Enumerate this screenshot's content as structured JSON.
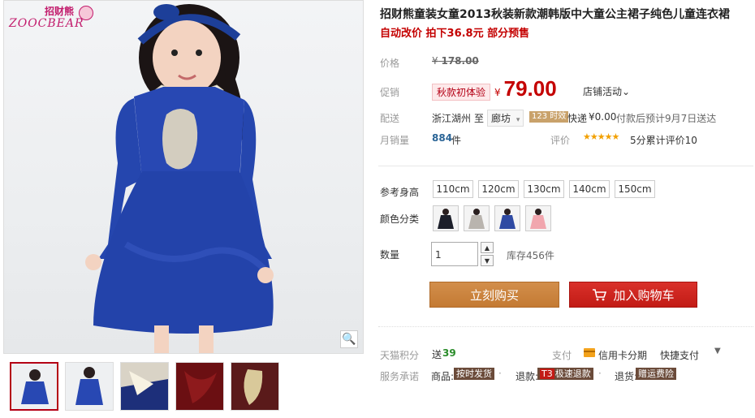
{
  "brand": {
    "name_cn": "招财熊",
    "name_en": "ZOOCBEAR"
  },
  "product": {
    "title": "招财熊童装女童2013秋装新款潮韩版中大童公主裙子纯色儿童连衣裙",
    "promo_line": "自动改价 拍下36.8元 部分预售"
  },
  "price": {
    "label": "价格",
    "currency": "¥",
    "original": "178.00"
  },
  "promotion": {
    "label": "促销",
    "tag": "秋款初体验",
    "currency": "¥",
    "price": "79.00",
    "store_activity": "店铺活动",
    "store_activity_arrow": "⌄"
  },
  "delivery": {
    "label": "配送",
    "from": "浙江湖州",
    "to_word": "至",
    "destination": "廊坊",
    "destination_arrow": "▾",
    "badge": "123 时效",
    "express_text": "快递",
    "fee": "¥0.00",
    "eta": "付款后预计9月7日送达"
  },
  "sales": {
    "label": "月销量",
    "count": "884",
    "unit": "件",
    "review_label": "评价",
    "stars": "★★★★★",
    "rating_text": "5分累计评价10"
  },
  "options": {
    "size_label": "参考身高",
    "sizes": [
      "110cm",
      "120cm",
      "130cm",
      "140cm",
      "150cm"
    ],
    "color_label": "颜色分类",
    "colors": [
      "#1c1f2a",
      "#b9b4ae",
      "#2f4aa3",
      "#f1a6ae"
    ]
  },
  "quantity": {
    "label": "数量",
    "value": "1",
    "up_icon": "▲",
    "down_icon": "▼",
    "stock": "库存456件"
  },
  "actions": {
    "buy_now": "立刻购买",
    "add_to_cart": "加入购物车"
  },
  "extras": {
    "points_label": "天猫积分",
    "points_prefix": "送",
    "points_value": "39",
    "pay_label": "支付",
    "credit": "信用卡分期",
    "quick_pay": "快捷支付",
    "quick_pay_arrow": "▼",
    "service_label": "服务承诺",
    "goods_label": "商品:",
    "goods_tag": "按时发货",
    "refund_label": "退款:",
    "refund_t3": "T3",
    "refund_tag": "极速退款",
    "return_label": "退货:",
    "return_tag": "赠运费险",
    "separator": "·"
  },
  "icons": {
    "zoom": "🔍",
    "accent": "#c40000",
    "buy_color": "#c47a33",
    "cart_color": "#c21b15"
  }
}
